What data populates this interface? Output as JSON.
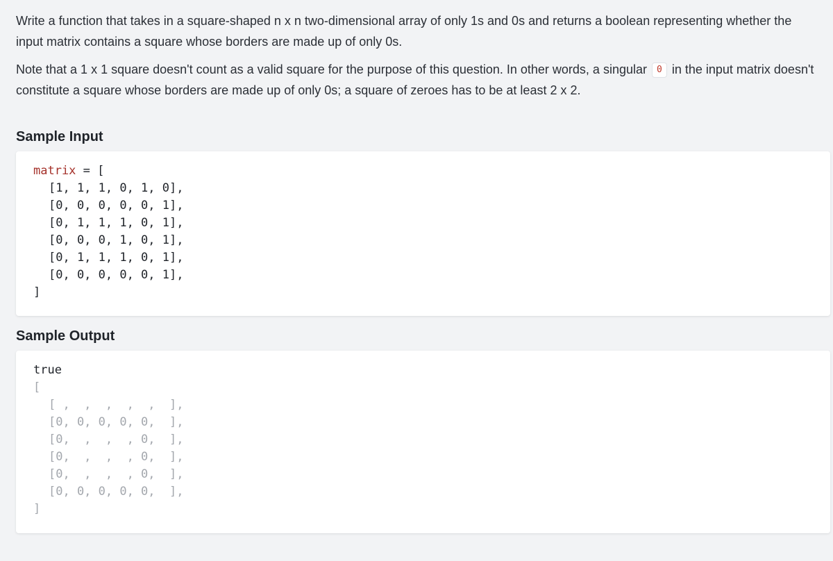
{
  "description": {
    "paragraph1": "Write a function that takes in a square-shaped n x n two-dimensional array of only 1s and 0s and returns a boolean representing whether the input matrix contains a square whose borders are made up of only 0s.",
    "paragraph2_before": "Note that a 1 x 1 square doesn't count as a valid square for the purpose of this question. In other words, a singular",
    "paragraph2_code": "0",
    "paragraph2_after": "in the input matrix doesn't constitute a square whose borders are made up of only 0s; a square of zeroes has to be at least 2 x 2."
  },
  "sample_input": {
    "title": "Sample Input",
    "variable": "matrix",
    "assign": " = [",
    "rows": [
      "[1, 1, 1, 0, 1, 0],",
      "[0, 0, 0, 0, 0, 1],",
      "[0, 1, 1, 1, 0, 1],",
      "[0, 0, 0, 1, 0, 1],",
      "[0, 1, 1, 1, 0, 1],",
      "[0, 0, 0, 0, 0, 1],"
    ],
    "close": "]"
  },
  "sample_output": {
    "title": "Sample Output",
    "result": "true",
    "open": "[",
    "rows": [
      "[ ,  ,  ,  ,  ,  ],",
      "[0, 0, 0, 0, 0,  ],",
      "[0,  ,  ,  , 0,  ],",
      "[0,  ,  ,  , 0,  ],",
      "[0,  ,  ,  , 0,  ],",
      "[0, 0, 0, 0, 0,  ],"
    ],
    "close": "]"
  }
}
